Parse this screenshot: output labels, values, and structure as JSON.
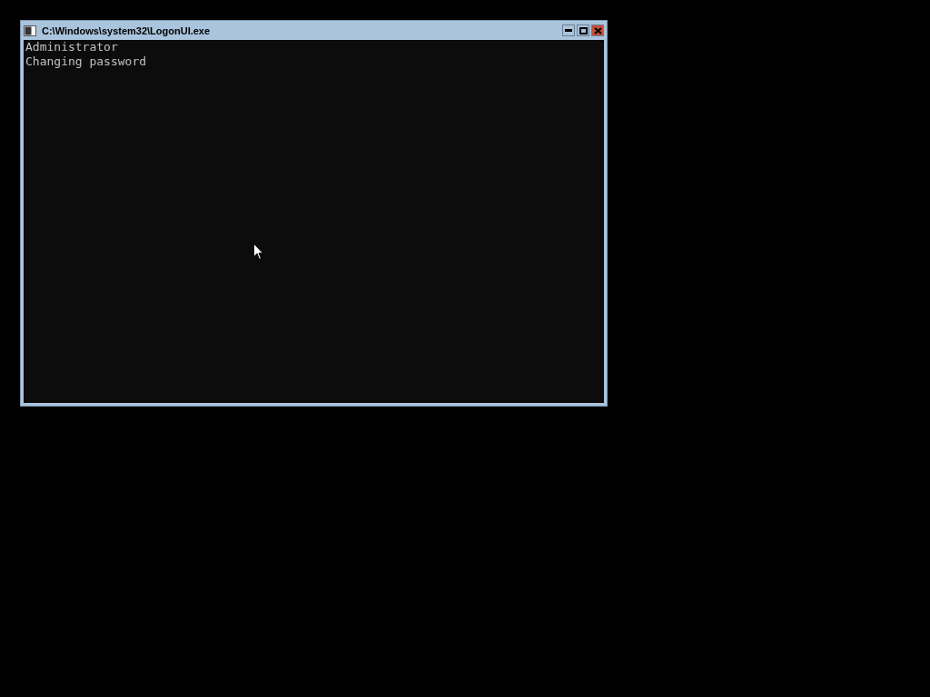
{
  "window": {
    "title": "C:\\Windows\\system32\\LogonUI.exe"
  },
  "console": {
    "lines": [
      "Administrator",
      "Changing password"
    ]
  }
}
